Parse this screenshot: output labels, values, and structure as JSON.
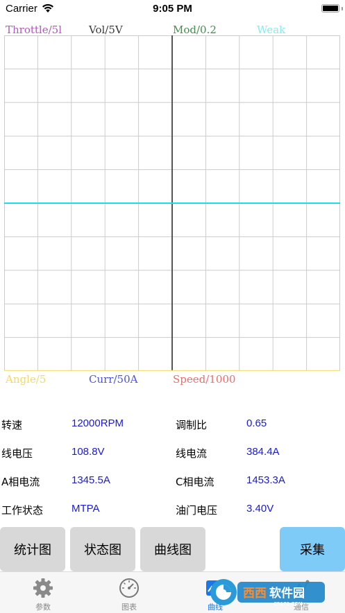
{
  "status": {
    "carrier": "Carrier",
    "time": "9:05 PM"
  },
  "chart_top_labels": [
    {
      "text": "Throttle/5l",
      "color": "#b05bb8"
    },
    {
      "text": "Vol/5V",
      "color": "#3a3a3a"
    },
    {
      "text": "Mod/0.2",
      "color": "#3f8f4a"
    },
    {
      "text": "Weak",
      "color": "#7ff0ef"
    }
  ],
  "chart_bottom_labels": [
    {
      "text": "Angle/5",
      "color": "#f0d96a"
    },
    {
      "text": "Curr/50A",
      "color": "#4b55d8"
    },
    {
      "text": "Speed/1000",
      "color": "#ef6b6b"
    }
  ],
  "chart_data": {
    "type": "line",
    "grid": true,
    "series": [
      {
        "color": "#18e0e0",
        "values": [
          0,
          0
        ]
      }
    ],
    "ylim": [
      -1,
      1
    ],
    "x_divisions": 10,
    "y_divisions": 10,
    "axis_colors": {
      "frame": "#f3e07a",
      "center": "#555555",
      "grid": "#cccccc"
    }
  },
  "params": [
    {
      "label": "转速",
      "value": "12000RPM",
      "label2": "调制比",
      "value2": "0.65"
    },
    {
      "label": "线电压",
      "value": "108.8V",
      "label2": "线电流",
      "value2": "384.4A"
    },
    {
      "label": "A相电流",
      "value": "1345.5A",
      "label2": "C相电流",
      "value2": "1453.3A"
    },
    {
      "label": "工作状态",
      "value": "MTPA",
      "label2": "油门电压",
      "value2": "3.40V"
    }
  ],
  "buttons": {
    "stats": "统计图",
    "state": "状态图",
    "curve": "曲线图",
    "collect": "采集"
  },
  "tabs": [
    {
      "label": "参数",
      "icon": "gear-icon"
    },
    {
      "label": "图表",
      "icon": "gauge-icon"
    },
    {
      "label": "曲线",
      "icon": "curve-icon"
    },
    {
      "label": "通信",
      "icon": "comm-icon"
    }
  ],
  "watermark": "西西软件园 CR173.com"
}
